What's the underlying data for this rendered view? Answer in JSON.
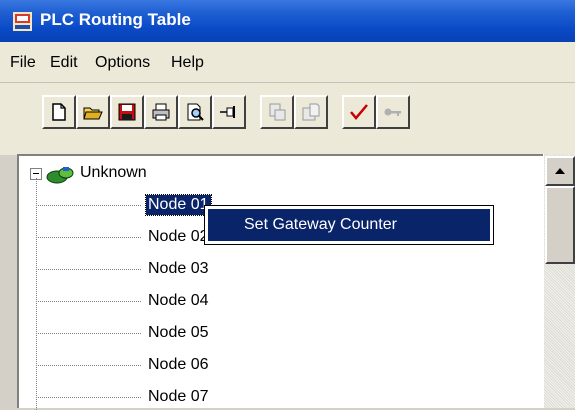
{
  "window": {
    "title": "PLC Routing Table"
  },
  "menu": [
    "File",
    "Edit",
    "Options",
    "Help"
  ],
  "toolbar": {
    "buttons": [
      {
        "icon": "new-file-icon",
        "enabled": true
      },
      {
        "icon": "open-folder-icon",
        "enabled": true
      },
      {
        "icon": "save-disk-icon",
        "enabled": true
      },
      {
        "icon": "printer-icon",
        "enabled": true
      },
      {
        "icon": "print-preview-icon",
        "enabled": true
      },
      {
        "icon": "pin-icon",
        "enabled": true
      },
      {
        "icon": "copy-node-icon",
        "enabled": false
      },
      {
        "icon": "paste-node-icon",
        "enabled": false
      },
      {
        "icon": "checkmark-icon",
        "enabled": true
      },
      {
        "icon": "key-icon",
        "enabled": false
      }
    ]
  },
  "tree": {
    "root_label": "Unknown",
    "root_expanded": true,
    "nodes": [
      "Node 01",
      "Node 02",
      "Node 03",
      "Node 04",
      "Node 05",
      "Node 06",
      "Node 07"
    ],
    "selected_index": 0
  },
  "context_menu": {
    "items": [
      "Set Gateway Counter"
    ]
  },
  "colors": {
    "title_bar": "#0a49c6",
    "selection": "#0a246a",
    "chrome": "#ece9d8"
  }
}
